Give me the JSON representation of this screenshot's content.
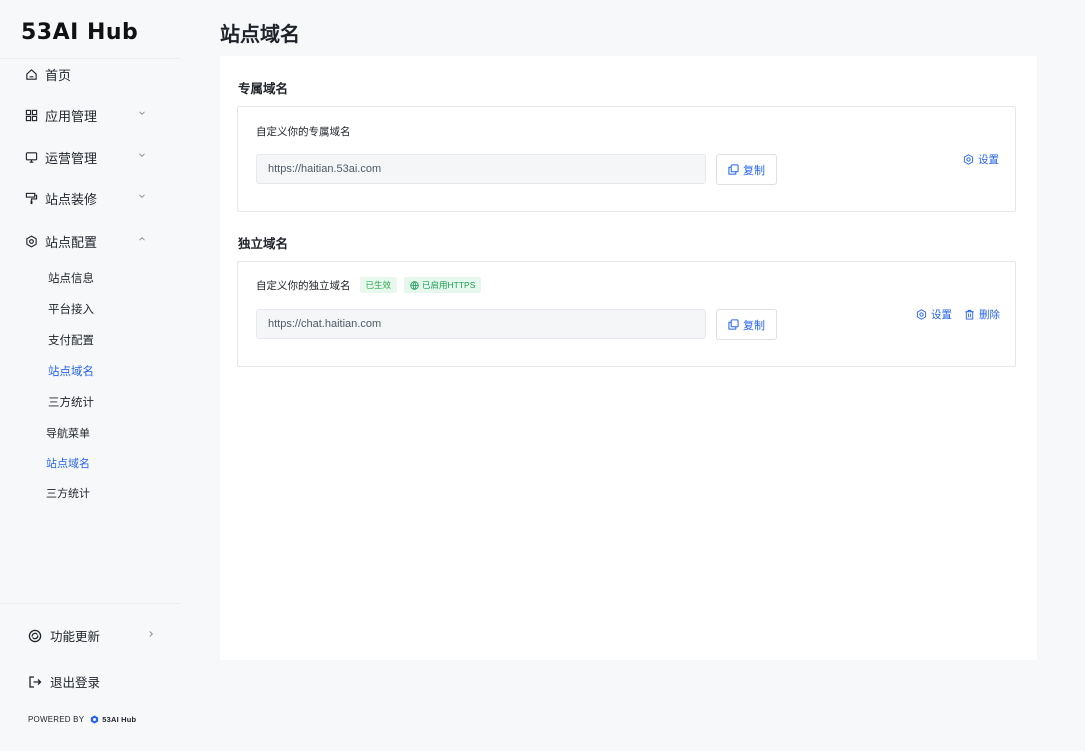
{
  "app": {
    "logo": "53AI Hub"
  },
  "sidebar": {
    "items": [
      {
        "label": "首页",
        "icon": "home-icon"
      },
      {
        "label": "应用管理",
        "icon": "apps-grid-icon"
      },
      {
        "label": "运营管理",
        "icon": "monitor-icon"
      },
      {
        "label": "站点装修",
        "icon": "paint-roller-icon"
      },
      {
        "label": "站点配置",
        "icon": "gear-icon"
      }
    ],
    "sub_items": [
      {
        "label": "站点信息"
      },
      {
        "label": "平台接入"
      },
      {
        "label": "支付配置"
      },
      {
        "label": "站点域名",
        "active": true
      },
      {
        "label": "三方统计"
      },
      {
        "label": "导航菜单"
      },
      {
        "label": "站点域名",
        "active": true
      },
      {
        "label": "三方统计"
      }
    ],
    "bottom": [
      {
        "label": "功能更新",
        "icon": "update-icon"
      },
      {
        "label": "退出登录",
        "icon": "logout-icon"
      }
    ],
    "powered_by": "POWERED BY",
    "powered_brand": "53AI Hub"
  },
  "page": {
    "title": "站点域名"
  },
  "exclusive": {
    "title": "专属域名",
    "label": "自定义你的专属域名",
    "url": "https://haitian.53ai.com",
    "copy_label": "复制",
    "settings_label": "设置"
  },
  "independent": {
    "title": "独立域名",
    "label": "自定义你的独立域名",
    "tag_active": "已生效",
    "tag_https": "已启用HTTPS",
    "url": "https://chat.haitian.com",
    "copy_label": "复制",
    "settings_label": "设置",
    "delete_label": "删除"
  },
  "colors": {
    "accent": "#2563eb",
    "success": "#2fa84f",
    "background": "#f7f8fa"
  }
}
